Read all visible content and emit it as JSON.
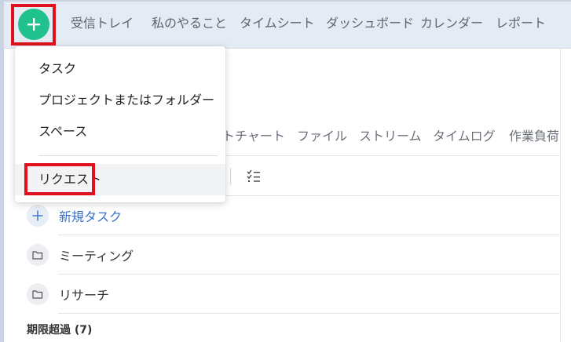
{
  "topnav": {
    "add_button_icon": "plus-icon",
    "items": [
      {
        "label": "受信トレイ"
      },
      {
        "label": "私のやること"
      },
      {
        "label": "タイムシート"
      },
      {
        "label": "ダッシュボード"
      },
      {
        "label": "カレンダー"
      },
      {
        "label": "レポート"
      }
    ]
  },
  "dropdown": {
    "items": [
      {
        "label": "タスク"
      },
      {
        "label": "プロジェクトまたはフォルダー"
      },
      {
        "label": "スペース"
      },
      {
        "label": "リクエスト"
      }
    ]
  },
  "tabs": [
    {
      "label": "トチャート"
    },
    {
      "label": "ファイル"
    },
    {
      "label": "ストリーム"
    },
    {
      "label": "タイムログ"
    },
    {
      "label": "作業負荷"
    }
  ],
  "list": {
    "new_task_label": "新規タスク",
    "folders": [
      {
        "label": "ミーティング"
      },
      {
        "label": "リサーチ"
      }
    ],
    "overdue_label": "期限超過 (7)"
  },
  "colors": {
    "accent_green": "#1fc28c",
    "highlight_red": "#e0111c",
    "link_blue": "#3a6fc9",
    "nav_background": "#e4ebf4"
  }
}
